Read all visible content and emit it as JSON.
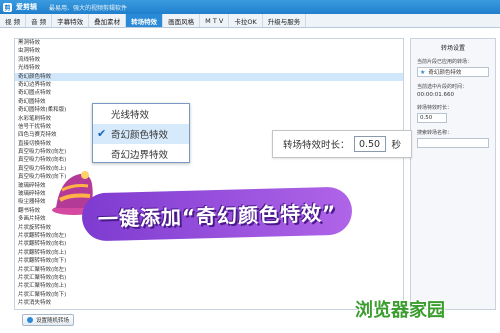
{
  "window": {
    "app_name": "爱剪辑",
    "slogan": "最易用、强大的视频剪辑软件",
    "icon_glyph": "剪"
  },
  "menu": [
    {
      "label": "视 频"
    },
    {
      "label": "音 频"
    },
    {
      "label": "字幕特效"
    },
    {
      "label": "叠加素材"
    },
    {
      "label": "转场特效",
      "active": true
    },
    {
      "label": "画面风格"
    },
    {
      "label": "M T V"
    },
    {
      "label": "卡拉OK"
    },
    {
      "label": "升级与服务"
    }
  ],
  "effects": [
    "黑洞特效",
    "虫洞特效",
    "流线特效",
    "光线特效",
    "奇幻颜色特效",
    "奇幻边界特效",
    "奇幻圆点特效",
    "奇幻圆特效",
    "奇幻圆特效(柔和版)",
    "水彩笔刷特效",
    "信号干扰特效",
    "四色马赛克特效",
    "直接切换特效",
    "真空吸力特效(向左)",
    "真空吸力特效(向右)",
    "真空吸力特效(向上)",
    "真空吸力特效(向下)",
    "玻璃碎特效",
    "玻璃碎特效",
    "吸尘器特效",
    "翻书特效",
    "多画片特效",
    "片状旋转特效",
    "片状翻转特效(向左)",
    "片状翻转特效(向右)",
    "片状翻转特效(向上)",
    "片状翻转特效(向下)",
    "片状汇聚特效(向左)",
    "片状汇聚特效(向右)",
    "片状汇聚特效(向上)",
    "片状汇聚特效(向下)",
    "片状消失特效"
  ],
  "selected_index": 4,
  "dropdown": [
    {
      "label": "光线特效",
      "checked": false
    },
    {
      "label": "奇幻颜色特效",
      "checked": true
    },
    {
      "label": "奇幻边界特效",
      "checked": false
    }
  ],
  "duration": {
    "label": "转场特效时长：",
    "value": "0.50",
    "unit": "秒"
  },
  "banner": "一键添加“奇幻颜色特效”",
  "right_panel": {
    "title": "转场设置",
    "current_label": "当前片段已应用的转场：",
    "current_value": "奇幻颜色特效",
    "time_label": "当前选中片段的时间：",
    "time_value": "00:00:01.660",
    "duration_label": "转场特效时长：",
    "duration_value": "0.50",
    "search_label": "搜索转场名称：",
    "search_placeholder": ""
  },
  "bottom_button": "设置随机转场",
  "watermark": "浏览器家园",
  "colors": {
    "title_bar": "#1f7fcc",
    "accent": "#2a8ad8",
    "banner": "#8b45d8",
    "watermark": "#3a9d2e"
  }
}
